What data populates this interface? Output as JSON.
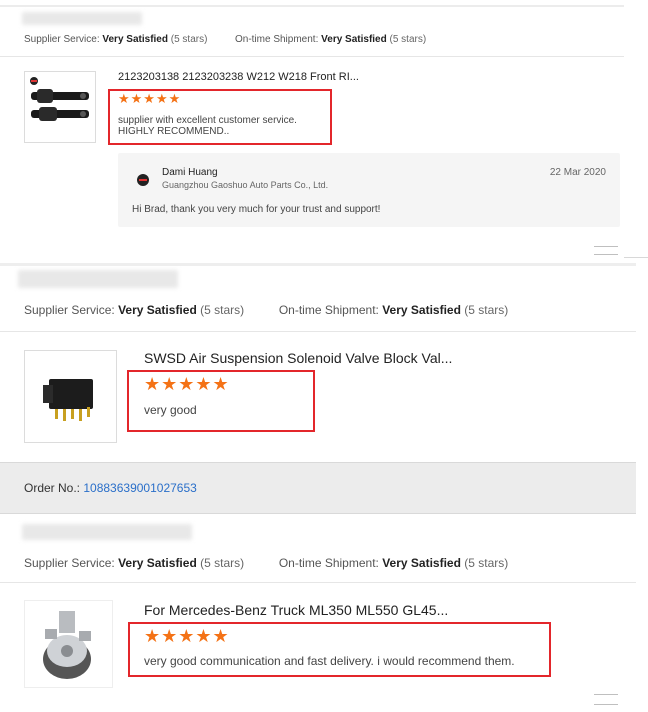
{
  "reviews": [
    {
      "supplier_service_label": "Supplier Service:",
      "supplier_service_value": "Very Satisfied",
      "supplier_service_stars": "(5 stars)",
      "shipment_label": "On-time Shipment:",
      "shipment_value": "Very Satisfied",
      "shipment_stars": "(5 stars)",
      "product_title": "2123203138 2123203238 W212 W218 Front RI...",
      "rating": 5,
      "stars_text": "★★★★★",
      "comment_line1": "supplier with excellent customer service.",
      "comment_line2": "HIGHLY RECOMMEND..",
      "reply": {
        "name": "Dami Huang",
        "company": "Guangzhou Gaoshuo Auto Parts Co., Ltd.",
        "date": "22 Mar 2020",
        "text": "Hi Brad, thank you very much for your trust and support!"
      }
    },
    {
      "supplier_service_label": "Supplier Service:",
      "supplier_service_value": "Very Satisfied",
      "supplier_service_stars": "(5 stars)",
      "shipment_label": "On-time Shipment:",
      "shipment_value": "Very Satisfied",
      "shipment_stars": "(5 stars)",
      "product_title": "SWSD Air Suspension Solenoid Valve Block Val...",
      "rating": 5,
      "stars_text": "★★★★★",
      "comment": "very good"
    },
    {
      "order_label": "Order No.:",
      "order_number": "10883639001027653",
      "supplier_service_label": "Supplier Service:",
      "supplier_service_value": "Very Satisfied",
      "supplier_service_stars": "(5 stars)",
      "shipment_label": "On-time Shipment:",
      "shipment_value": "Very Satisfied",
      "shipment_stars": "(5 stars)",
      "product_title": "For Mercedes-Benz Truck ML350 ML550 GL45...",
      "rating": 5,
      "stars_text": "★★★★★",
      "comment": "very good communication and fast delivery. i would recommend them."
    }
  ],
  "colors": {
    "star": "#f47216",
    "highlight_box": "#e3262b",
    "link": "#2a6fc9",
    "order_bar": "#ececec"
  },
  "icons": [
    "product-thumbnail-air-spring",
    "product-thumbnail-valve-block",
    "product-thumbnail-pump",
    "supplier-logo-icon",
    "collapse-lines-icon"
  ]
}
